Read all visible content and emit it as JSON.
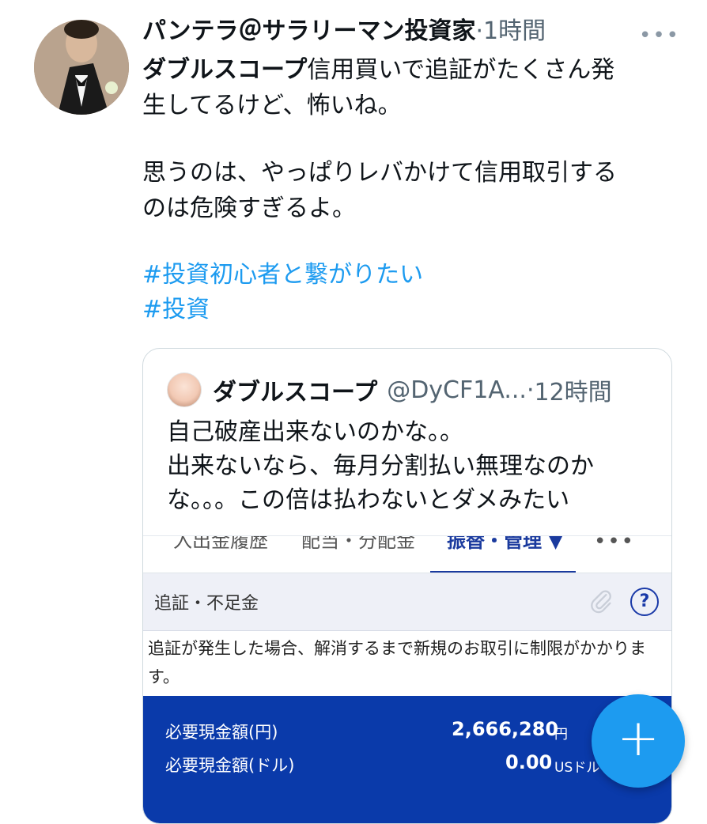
{
  "tweet": {
    "author_name": "パンテラ＠サラリーマン投資家",
    "separator": "·",
    "time": "1時間",
    "more": "•••",
    "body_bold": "ダブルスコープ",
    "body_line1_rest": "信用買いで追証がたくさん発",
    "body_line2": "生してるけど、怖いね。",
    "body_para2": "思うのは、やっぱりレバかけて信用取引する\nのは危険すぎるよ。",
    "hashtags": [
      "#投資初心者と繋がりたい",
      "#投資"
    ]
  },
  "quote": {
    "name": "ダブルスコープ",
    "handle": "@DyCF1A...",
    "separator": "·",
    "time": "12時間",
    "text": "自己破産出来ないのかな。。\n出来ないなら、毎月分割払い無理なのか\nな。。。この倍は払わないとダメみたい"
  },
  "screenshot": {
    "tabs": [
      "入出金履歴",
      "配当・分配金",
      "振替・管理 ▼"
    ],
    "tab_more": "•••",
    "section_title": "追証・不足金",
    "help_label": "?",
    "note": "追証が発生した場合、解消するまで新規のお取引に制限がかかります。",
    "rows": [
      {
        "label": "必要現金額(円)",
        "value": "2,666,280",
        "unit": "円"
      },
      {
        "label": "必要現金額(ドル)",
        "value": "0.00",
        "unit": "USドル"
      }
    ]
  },
  "fab": {
    "label": "+"
  }
}
